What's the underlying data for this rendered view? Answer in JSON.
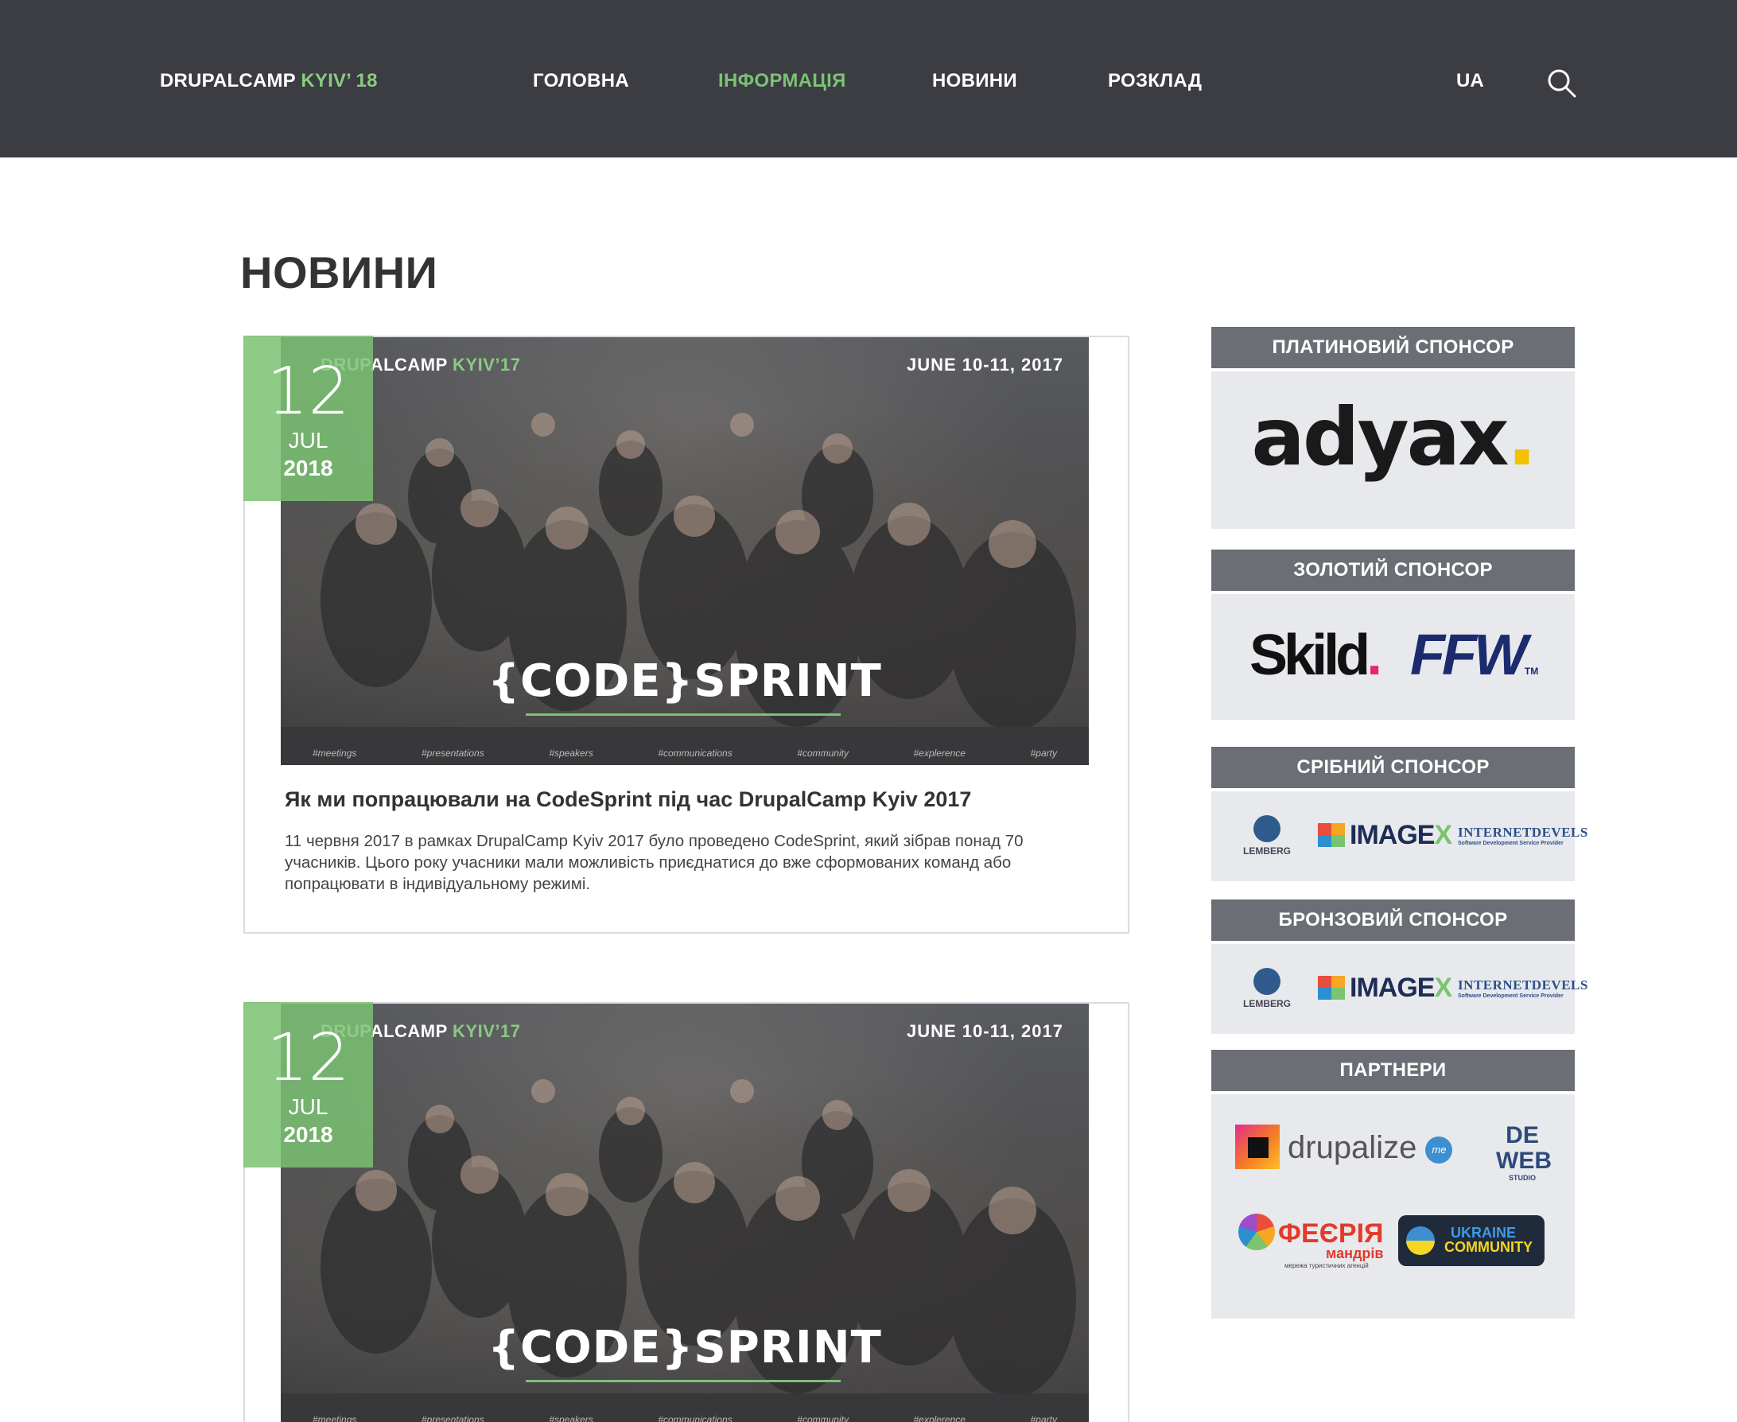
{
  "header": {
    "logo_main": "DRUPALCAMP",
    "logo_accent": "KYIV’ 18",
    "nav": [
      {
        "label": "ГОЛОВНА",
        "active": false
      },
      {
        "label": "ІНФОРМАЦІЯ",
        "active": true
      },
      {
        "label": "НОВИНИ",
        "active": false
      },
      {
        "label": "РОЗКЛАД",
        "active": false
      }
    ],
    "lang": "UA",
    "search_icon": "search-icon"
  },
  "page": {
    "title": "НОВИНИ"
  },
  "colors": {
    "topbar": "#3c3d42",
    "accent_green": "#7bc276",
    "sponsor_header": "#6b6e74",
    "sponsor_body": "#e8e9ec"
  },
  "news": [
    {
      "day": "12",
      "month": "JUL",
      "year": "2018",
      "image": {
        "brand_main": "DRUPALCAMP",
        "brand_accent": "KYIV’17",
        "dates": "JUNE 10-11, 2017",
        "headline": "{CODE}SPRINT",
        "tags": [
          "#meetings",
          "#presentations",
          "#speakers",
          "#communications",
          "#community",
          "#explerence",
          "#party"
        ]
      },
      "title": "Як ми попрацювали на CodeSprint під час DrupalCamp Kyiv 2017",
      "excerpt": "11 червня 2017 в рамках DrupalCamp Kyiv 2017 було проведено CodeSprint, який зібрав понад 70 учасників. Цього року учасники мали можливість приєднатися до вже сформованих команд або попрацювати в індивідуальному режимі."
    },
    {
      "day": "12",
      "month": "JUL",
      "year": "2018",
      "image": {
        "brand_main": "DRUPALCAMP",
        "brand_accent": "KYIV’17",
        "dates": "JUNE 10-11, 2017",
        "headline": "{CODE}SPRINT",
        "tags": [
          "#meetings",
          "#presentations",
          "#speakers",
          "#communications",
          "#community",
          "#explerence",
          "#party"
        ]
      }
    }
  ],
  "sponsors": {
    "platinum": {
      "heading": "ПЛАТИНОВИЙ СПОНСОР",
      "logo": "adyax"
    },
    "gold": {
      "heading": "ЗОЛОТИЙ СПОНСОР",
      "logos": [
        "Skild",
        "FFW"
      ],
      "ffw_tm": "TM"
    },
    "silver": {
      "heading": "СРІБНИЙ СПОНСОР",
      "lemberg": "LEMBERG",
      "imagex_main": "IMAGE",
      "imagex_x": "X",
      "idev": "INTERNETDEVELS",
      "idev_sub": "Software Development Service Provider"
    },
    "bronze": {
      "heading": "БРОНЗОВИЙ СПОНСОР",
      "lemberg": "LEMBERG",
      "imagex_main": "IMAGE",
      "imagex_x": "X",
      "idev": "INTERNETDEVELS",
      "idev_sub": "Software Development Service Provider"
    },
    "partners": {
      "heading": "ПАРТНЕРИ",
      "drupalize": "drupalize",
      "drupalize_me": "me",
      "deweb_1": "DE",
      "deweb_2": "WEB",
      "deweb_studio": "STUDIO",
      "feeria": "ФЕЄРІЯ",
      "feeria_sub": "мандрів",
      "feeria_tiny": "мережа туристичних агенцій",
      "ukraine_1": "UKRAINE",
      "ukraine_2": "COMMUNITY"
    }
  }
}
